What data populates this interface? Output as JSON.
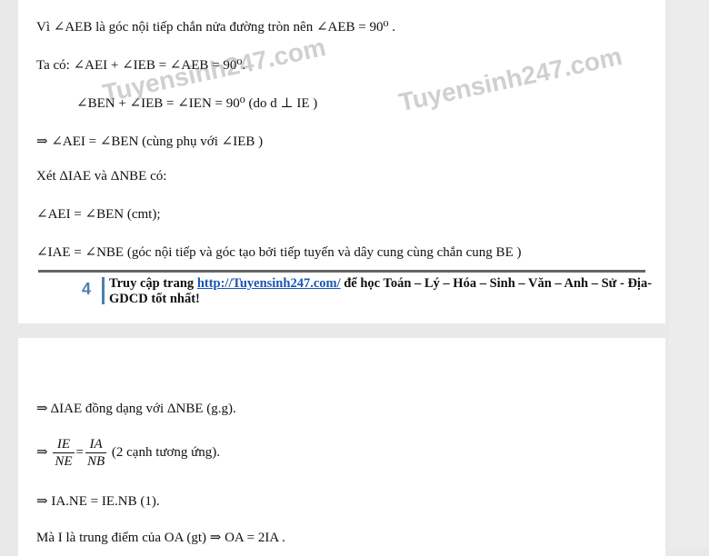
{
  "lines": [
    "Vì ∠AEB là góc nội tiếp chắn nửa đường tròn nên ∠AEB = 90⁰ .",
    "Ta có: ∠AEI + ∠IEB = ∠AEB = 90⁰.",
    "∠BEN + ∠IEB = ∠IEN = 90⁰ (do d ⊥ IE )",
    "⇒ ∠AEI = ∠BEN (cùng phụ với ∠IEB )",
    "Xét ΔIAE và ΔNBE có:",
    "∠AEI = ∠BEN (cmt);",
    "∠IAE = ∠NBE (góc nội tiếp và góc tạo bởi tiếp tuyến và dây cung cùng chắn cung BE )"
  ],
  "watermarks": [
    "Tuyensinh247.com",
    "Tuyensinh247.com"
  ],
  "footer": {
    "page_number": "4",
    "prefix": "Truy cập trang ",
    "link": "http://Tuyensinh247.com/",
    "suffix": " để học Toán – Lý – Hóa – Sinh – Văn – Anh – Sử - Địa- GDCD tốt nhất!"
  },
  "lines2": [
    "⇒ ΔIAE đồng dạng với ΔNBE (g.g).",
    "(2 cạnh tương ứng).",
    "⇒ IA.NE = IE.NB (1).",
    "Mà I là trung điểm của OA (gt) ⇒ OA = 2IA ."
  ],
  "fraction": {
    "left_num": "IE",
    "left_den": "NE",
    "right_num": "IA",
    "right_den": "NB",
    "prefix": "⇒"
  }
}
